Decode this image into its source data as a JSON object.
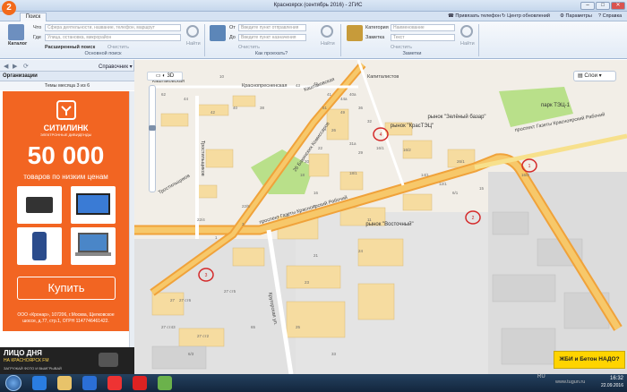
{
  "app": {
    "title": "Красноярск (сентябрь 2016) - 2ГИС",
    "logo": "2"
  },
  "tabs": [
    "Поиск"
  ],
  "topbar": {
    "phone": "Привязать телефон",
    "updates": "Центр обновлений",
    "params": "Параметры",
    "help": "Справка"
  },
  "ribbon": {
    "catalog": "Каталог",
    "what_label": "Что",
    "what_ph": "Сфера деятельности, название, телефон, маршрут",
    "where_label": "Где",
    "where_ph": "Улица, остановка, микрорайон",
    "find": "Найти",
    "advanced": "Расширенный поиск",
    "clear": "Очистить",
    "g1": "Основной поиск",
    "from_label": "От",
    "from_ph": "Введите пункт отправления",
    "to_label": "До",
    "to_ph": "Введите пункт назначения",
    "g2": "Как проехать?",
    "cat_label": "Категория",
    "cat_ph": "Наименование",
    "note_label": "Заметка",
    "note_ph": "Текст",
    "g3": "Заметки"
  },
  "panel": {
    "directory": "Справочник",
    "orgs": "Организации",
    "theme": "Темы месяца 3 из 6"
  },
  "ad": {
    "brand": "СИТИЛИНК",
    "brand_sub": "ЭЛЕКТРОННЫЕ ДИВИДЕНДЫ",
    "amount": "50 000",
    "subtitle": "товаров по низким ценам",
    "buy": "Купить",
    "legal": "ООО «Кронар», 107206, г.Москва, Щелковское шоссе, д.77, стр.1, ОГРН 1147746461422."
  },
  "banner": {
    "line1": "ЛИЦО ДНЯ",
    "line2": "НА КРАСНОЯРСК FM",
    "line3": "ЗАГРУЖАЙ ФОТО И ВЫИГРЫВАЙ"
  },
  "map": {
    "layers": "Слои",
    "streets": [
      "проспект Газеты Красноярский Рабочий",
      "проспект Газеты Красноярский Рабочий",
      "26 Бакинских Комиссаров",
      "Тростильщиков",
      "Тростильщиков",
      "Краснопресненская",
      "Каштаковская",
      "Каштаковская",
      "Капиталистов",
      "Кругорская ул."
    ],
    "places": [
      "рынок \"КрасТЭЦ\"",
      "рынок \"Зелёный базар\"",
      "рынок \"Восточный\"",
      "парк ТЭЦ-1"
    ],
    "houses": [
      "62",
      "44",
      "42",
      "40",
      "38",
      "10",
      "43",
      "45",
      "41",
      "44a",
      "51",
      "40a",
      "49",
      "36",
      "32",
      "26",
      "22",
      "20",
      "18",
      "16",
      "31a",
      "29",
      "16/1",
      "16/2",
      "18/1",
      "14/1",
      "12/1",
      "6/1",
      "11",
      "7",
      "5",
      "3",
      "1",
      "27",
      "23",
      "25",
      "21",
      "24",
      "22/5",
      "22/4",
      "26/1",
      "27 ст6",
      "27 ст43",
      "27 ст5",
      "27 ст2",
      "6/3",
      "65",
      "33",
      "16/3",
      "15"
    ],
    "markers": [
      "1",
      "2",
      "3",
      "4"
    ],
    "ad": "ЖБИ и Бетон НАДО?"
  },
  "taskbar": {
    "time": "16:32",
    "date": "22.09.2016",
    "watermark": "www.tugun.ru"
  }
}
